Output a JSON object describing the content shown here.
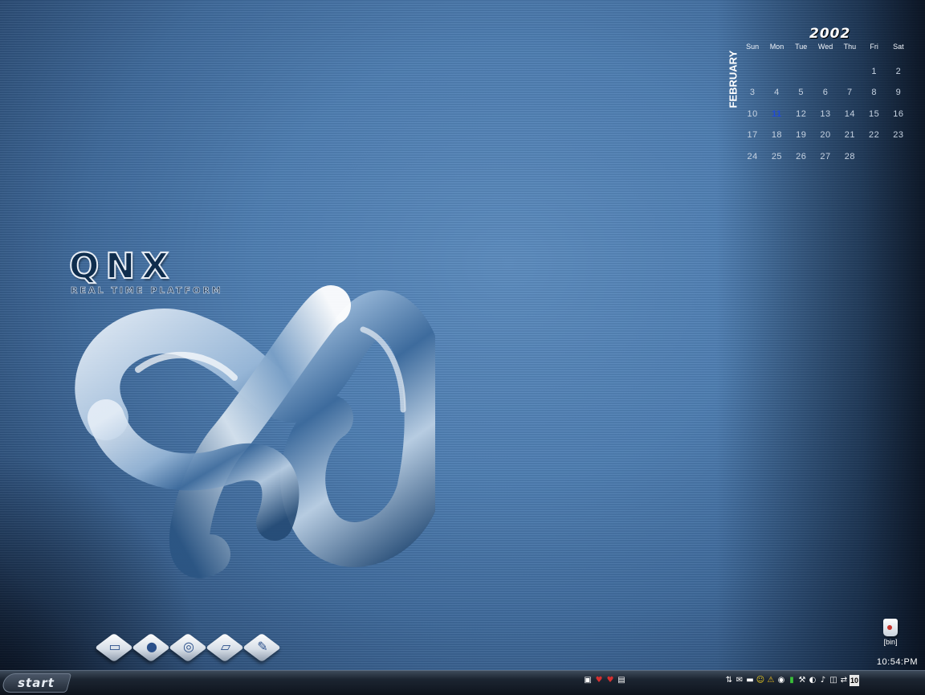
{
  "calendar": {
    "year": "2002",
    "month": "FEBRUARY",
    "weekdays": [
      "Sun",
      "Mon",
      "Tue",
      "Wed",
      "Thu",
      "Fri",
      "Sat"
    ],
    "today": "11",
    "days": [
      "",
      "",
      "",
      "",
      "",
      "1",
      "2",
      "3",
      "4",
      "5",
      "6",
      "7",
      "8",
      "9",
      "10",
      "11",
      "12",
      "13",
      "14",
      "15",
      "16",
      "17",
      "18",
      "19",
      "20",
      "21",
      "22",
      "23",
      "24",
      "25",
      "26",
      "27",
      "28",
      "",
      ""
    ]
  },
  "logo": {
    "name": "QNX",
    "tagline": "REAL TIME PLATFORM"
  },
  "launcher": [
    {
      "name": "file-manager-icon",
      "glyph": "▭"
    },
    {
      "name": "web-browser-icon",
      "glyph": "●"
    },
    {
      "name": "mail-icon",
      "glyph": "◎"
    },
    {
      "name": "terminal-icon",
      "glyph": "▱"
    },
    {
      "name": "editor-icon",
      "glyph": "✎"
    }
  ],
  "desktop": {
    "bin_label": "[bin]"
  },
  "taskbar": {
    "start_label": "start",
    "clock": "10:54:PM",
    "tray_badge": "10",
    "tray_mid": [
      "app-icon",
      "heart-icon",
      "heart-icon",
      "document-icon"
    ],
    "tray_right": [
      "network-icon",
      "mail-icon",
      "monitor-icon",
      "smiley-icon",
      "warning-icon",
      "cd-icon",
      "battery-icon",
      "tools-icon",
      "speaker-icon",
      "volume-icon",
      "window-icon",
      "link-icon"
    ]
  },
  "colors": {
    "desktop_blue": "#4f7fb3",
    "taskbar_dark": "#0e141d",
    "today_highlight": "#1f4ad8"
  }
}
